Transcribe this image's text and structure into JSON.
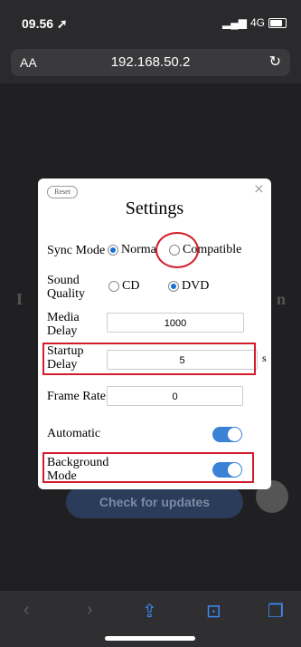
{
  "status": {
    "time": "09.56",
    "network": "4G"
  },
  "browser": {
    "text_size": "AA",
    "url": "192.168.50.2"
  },
  "background": {
    "letter_left": "I",
    "letter_right": "n",
    "check_updates_label": "Check for updates"
  },
  "modal": {
    "reset_label": "Reset",
    "close_label": "×",
    "title": "Settings",
    "sync_mode": {
      "label": "Sync Mode",
      "options": [
        "Norma",
        "Compatible"
      ],
      "selected": "Norma"
    },
    "sound_quality": {
      "label_line1": "Sound",
      "label_line2": "Quality",
      "options": [
        "CD",
        "DVD"
      ],
      "selected": "DVD"
    },
    "media_delay": {
      "label_line1": "Media",
      "label_line2": "Delay",
      "value": "1000"
    },
    "startup_delay": {
      "label_line1": "Startup",
      "label_line2": "Delay",
      "value": "5",
      "unit": "s"
    },
    "frame_rate": {
      "label": "Frame Rate",
      "value": "0"
    },
    "automatic": {
      "label": "Automatic",
      "enabled": true
    },
    "background_mode": {
      "label": "Background",
      "label_line2": "Mode",
      "enabled": true
    }
  },
  "annotation_color": "#d21c2b",
  "toggle_color": "#3b82d6"
}
